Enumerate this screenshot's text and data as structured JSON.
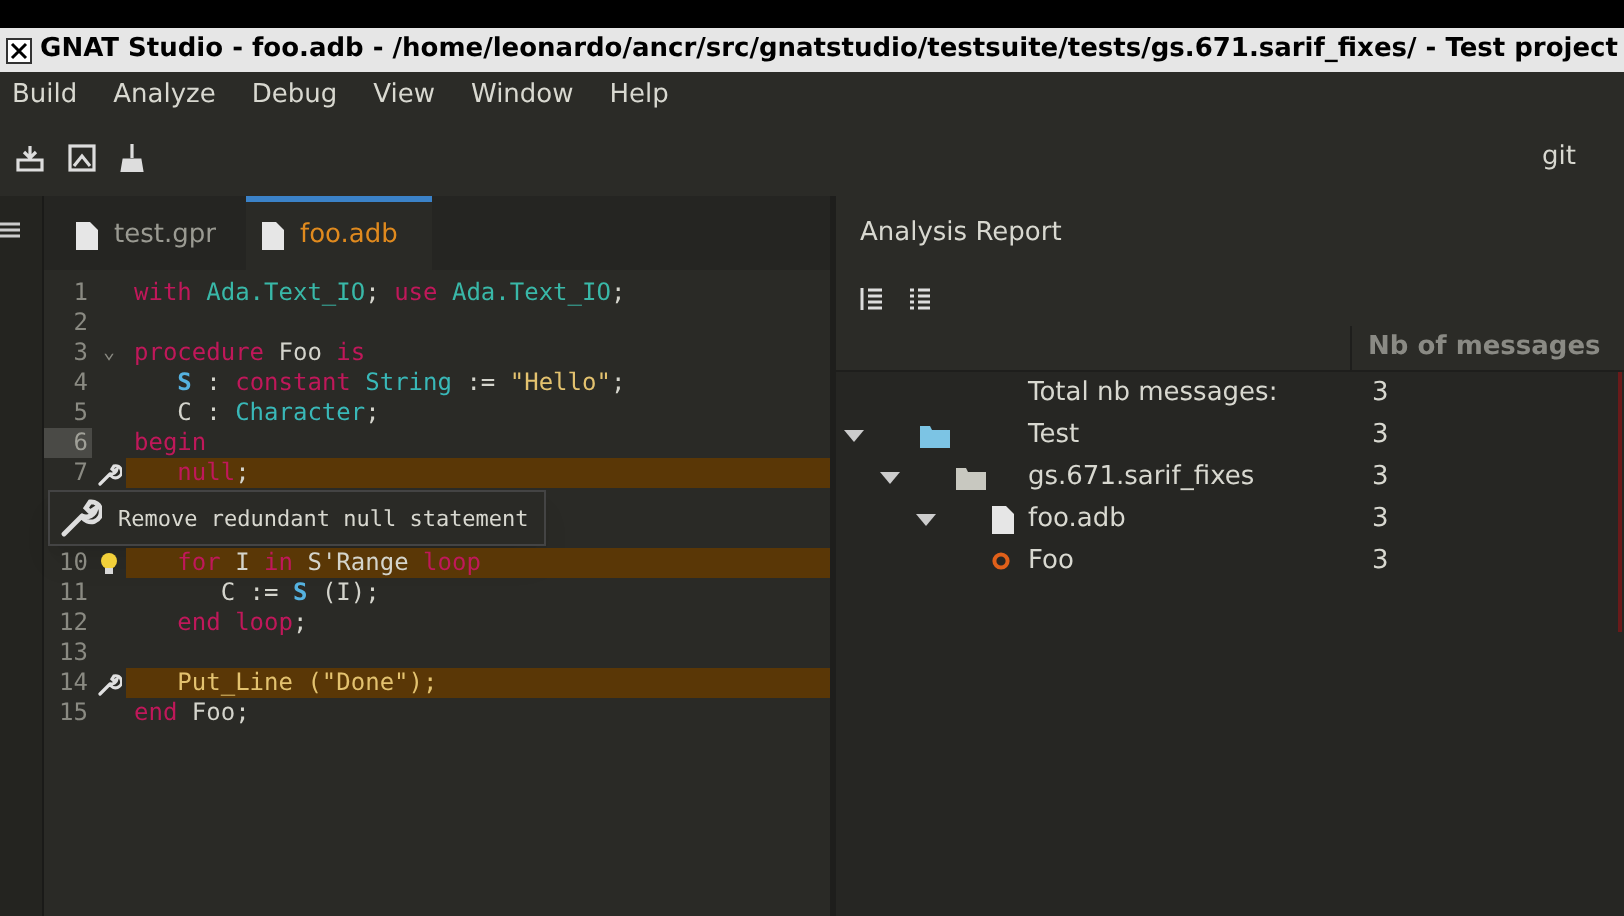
{
  "window": {
    "title": "GNAT Studio - foo.adb - /home/leonardo/ancr/src/gnatstudio/testsuite/tests/gs.671.sarif_fixes/ - Test project"
  },
  "menu": [
    "Build",
    "Analyze",
    "Debug",
    "View",
    "Window",
    "Help"
  ],
  "toolbar": {
    "vcs_label": "git"
  },
  "editor": {
    "tabs": [
      {
        "label": "test.gpr",
        "selected": false
      },
      {
        "label": "foo.adb",
        "selected": true
      }
    ],
    "lines": [
      {
        "number": "1",
        "tokens": [
          {
            "kind": "kw",
            "text": "with"
          },
          {
            "kind": "pkg",
            "text": " Ada.Text_IO"
          },
          {
            "kind": "plain",
            "text": "; "
          },
          {
            "kind": "kw",
            "text": "use"
          },
          {
            "kind": "pkg",
            "text": " Ada.Text_IO"
          },
          {
            "kind": "plain",
            "text": ";"
          }
        ]
      },
      {
        "number": "2"
      },
      {
        "number": "3",
        "fold": "⌄",
        "tokens": [
          {
            "kind": "kw",
            "text": "procedure"
          },
          {
            "kind": "plain",
            "text": " Foo "
          },
          {
            "kind": "kw",
            "text": "is"
          }
        ]
      },
      {
        "number": "4",
        "tokens": [
          {
            "kind": "var",
            "text": "   S"
          },
          {
            "kind": "plain",
            "text": " : "
          },
          {
            "kind": "kw",
            "text": "constant"
          },
          {
            "kind": "type",
            "text": " String"
          },
          {
            "kind": "plain",
            "text": " := "
          },
          {
            "kind": "str",
            "text": "\"Hello\""
          },
          {
            "kind": "plain",
            "text": ";"
          }
        ]
      },
      {
        "number": "5",
        "tokens": [
          {
            "kind": "plain",
            "text": "   C : "
          },
          {
            "kind": "type",
            "text": "Character"
          },
          {
            "kind": "plain",
            "text": ";"
          }
        ]
      },
      {
        "number": "6",
        "current": true,
        "tokens": [
          {
            "kind": "kw",
            "text": "begin"
          }
        ]
      },
      {
        "number": "7",
        "fix": true,
        "highlight": true,
        "tokens": [
          {
            "kind": "kw",
            "text": "   null"
          },
          {
            "kind": "plain",
            "text": ";"
          }
        ],
        "tooltip": "Remove redundant null statement"
      },
      {
        "number": "10",
        "hint": true,
        "highlight": true,
        "tokens": [
          {
            "kind": "kw",
            "text": "   for"
          },
          {
            "kind": "plain",
            "text": " I "
          },
          {
            "kind": "kw",
            "text": "in"
          },
          {
            "kind": "plain",
            "text": " S'Range "
          },
          {
            "kind": "kw",
            "text": "loop"
          }
        ]
      },
      {
        "number": "11",
        "tokens": [
          {
            "kind": "plain",
            "text": "      C := "
          },
          {
            "kind": "var",
            "text": "S"
          },
          {
            "kind": "plain",
            "text": " (I);"
          }
        ]
      },
      {
        "number": "12",
        "tokens": [
          {
            "kind": "kw",
            "text": "   end loop"
          },
          {
            "kind": "plain",
            "text": ";"
          }
        ]
      },
      {
        "number": "13"
      },
      {
        "number": "14",
        "fix": true,
        "highlight": true,
        "tokens": [
          {
            "kind": "str",
            "text": "   Put_Line (\"Done\");"
          }
        ]
      },
      {
        "number": "15",
        "tokens": [
          {
            "kind": "kw",
            "text": "end"
          },
          {
            "kind": "plain",
            "text": " Foo;"
          }
        ]
      }
    ]
  },
  "report": {
    "title": "Analysis Report",
    "columns": [
      "Nb of messages"
    ],
    "total": {
      "label": "Total nb messages:",
      "count": "3"
    },
    "tree": [
      {
        "kind": "project",
        "label": "Test",
        "count": "3",
        "expanded": true,
        "children": [
          {
            "kind": "folder",
            "label": "gs.671.sarif_fixes",
            "count": "3",
            "expanded": true,
            "children": [
              {
                "kind": "file",
                "label": "foo.adb",
                "count": "3",
                "expanded": true,
                "children": [
                  {
                    "kind": "entity",
                    "label": "Foo",
                    "count": "3"
                  }
                ]
              }
            ]
          }
        ]
      }
    ]
  }
}
